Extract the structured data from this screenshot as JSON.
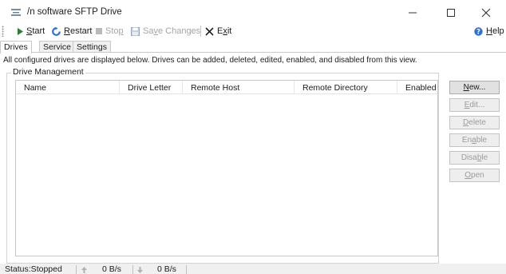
{
  "window": {
    "title": "/n software SFTP Drive",
    "controls": {
      "minimize": "minimize",
      "maximize": "maximize",
      "close": "close"
    }
  },
  "toolbar": {
    "start": {
      "first": "S",
      "rest": "tart",
      "icon": "play-icon"
    },
    "restart": {
      "first": "R",
      "rest": "estart",
      "icon": "restart-icon"
    },
    "stop": {
      "pre": "Sto",
      "under": "p",
      "icon": "stop-icon"
    },
    "save": {
      "pre": "Sa",
      "under": "v",
      "post": "e Changes",
      "icon": "save-icon"
    },
    "exit": {
      "pre": "E",
      "under": "x",
      "post": "it",
      "icon": "close-x-icon"
    },
    "help": {
      "first": "H",
      "rest": "elp",
      "icon": "help-icon"
    }
  },
  "tabs": [
    "Drives",
    "Service",
    "Settings"
  ],
  "description": "All configured drives are displayed below. Drives can be added, deleted, edited, enabled, and disabled from this view.",
  "group_title": "Drive Management",
  "table": {
    "columns": [
      "Name",
      "Drive Letter",
      "Remote Host",
      "Remote Directory",
      "Enabled"
    ],
    "rows": []
  },
  "buttons": {
    "new": {
      "first": "N",
      "rest": "ew..."
    },
    "edit": {
      "first": "E",
      "rest": "dit..."
    },
    "delete": {
      "first": "D",
      "rest": "elete"
    },
    "enable": {
      "pre": "En",
      "under": "a",
      "post": "ble"
    },
    "disable": {
      "pre": "Disa",
      "under": "b",
      "post": "le"
    },
    "open": {
      "first": "O",
      "rest": "pen"
    }
  },
  "status": {
    "label": "Status:Stopped",
    "upload_rate": "0  B/s",
    "download_rate": "0  B/s"
  },
  "colors": {
    "accent_blue": "#2b6fd6",
    "play_green": "#2e7d32",
    "disabled_text": "#a5a5a5"
  }
}
